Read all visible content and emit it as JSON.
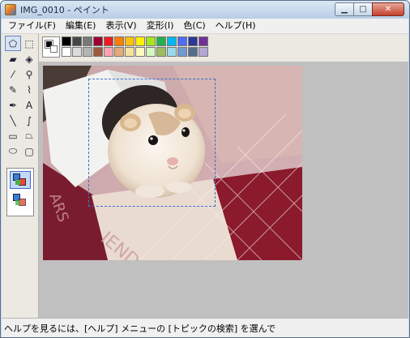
{
  "window": {
    "title": "IMG_0010 - ペイント",
    "controls": [
      "▁",
      "□",
      "✕"
    ]
  },
  "menu": [
    "ファイル(F)",
    "編集(E)",
    "表示(V)",
    "変形(I)",
    "色(C)",
    "ヘルプ(H)"
  ],
  "tools": [
    {
      "name": "free-select-icon",
      "glyph": "⬠"
    },
    {
      "name": "rect-select-icon",
      "glyph": "⬚"
    },
    {
      "name": "eraser-icon",
      "glyph": "▰"
    },
    {
      "name": "fill-bucket-icon",
      "glyph": "◈"
    },
    {
      "name": "color-picker-icon",
      "glyph": "⁄"
    },
    {
      "name": "magnifier-icon",
      "glyph": "⚲"
    },
    {
      "name": "pencil-icon",
      "glyph": "✎"
    },
    {
      "name": "brush-icon",
      "glyph": "⌇"
    },
    {
      "name": "airbrush-icon",
      "glyph": "✒"
    },
    {
      "name": "text-icon",
      "glyph": "A"
    },
    {
      "name": "line-icon",
      "glyph": "╲"
    },
    {
      "name": "curve-icon",
      "glyph": "∫"
    },
    {
      "name": "rectangle-icon",
      "glyph": "▭"
    },
    {
      "name": "polygon-icon",
      "glyph": "⏢"
    },
    {
      "name": "ellipse-icon",
      "glyph": "⬭"
    },
    {
      "name": "rounded-rect-icon",
      "glyph": "▢"
    }
  ],
  "palette": {
    "foreground": "#000000",
    "background": "#ffffff",
    "row1": [
      "#000000",
      "#464646",
      "#787878",
      "#990030",
      "#ed1c24",
      "#ff7e00",
      "#ffc20e",
      "#fff200",
      "#a8e61d",
      "#22b14c",
      "#00b7ef",
      "#4d6df3",
      "#2f3699",
      "#6f3198"
    ],
    "row2": [
      "#ffffff",
      "#dcdcdc",
      "#b4b4b4",
      "#9c5a3c",
      "#ffa3b1",
      "#e5aa7a",
      "#f5e49c",
      "#fff9bd",
      "#d3f9bc",
      "#9dbb61",
      "#99d9ea",
      "#709ad1",
      "#546d8e",
      "#b5a5d5"
    ]
  },
  "status": {
    "text": "ヘルプを見るには、[ヘルプ] メニューの [トピックの検索] を選んで"
  }
}
